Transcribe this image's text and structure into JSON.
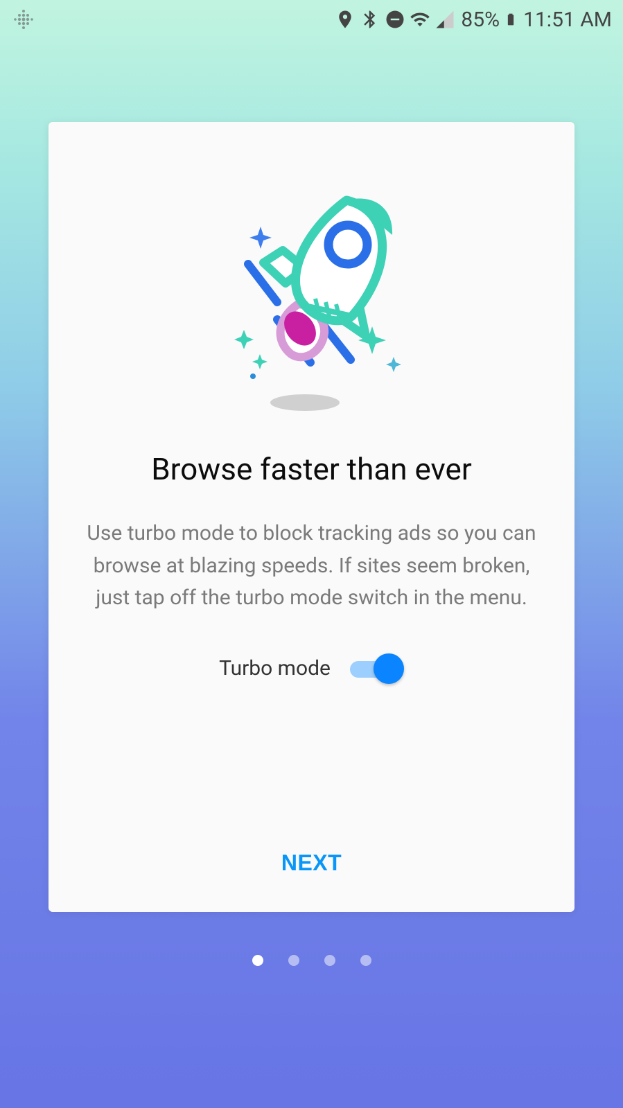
{
  "status_bar": {
    "battery_pct": "85%",
    "time": "11:51 AM"
  },
  "card": {
    "headline": "Browse faster than ever",
    "description": "Use turbo mode to block tracking ads so you can browse at blazing speeds. If sites seem broken, just tap off the turbo mode switch in the menu.",
    "toggle_label": "Turbo mode",
    "next_label": "NEXT"
  },
  "pagination": {
    "total": 4,
    "active": 0
  }
}
